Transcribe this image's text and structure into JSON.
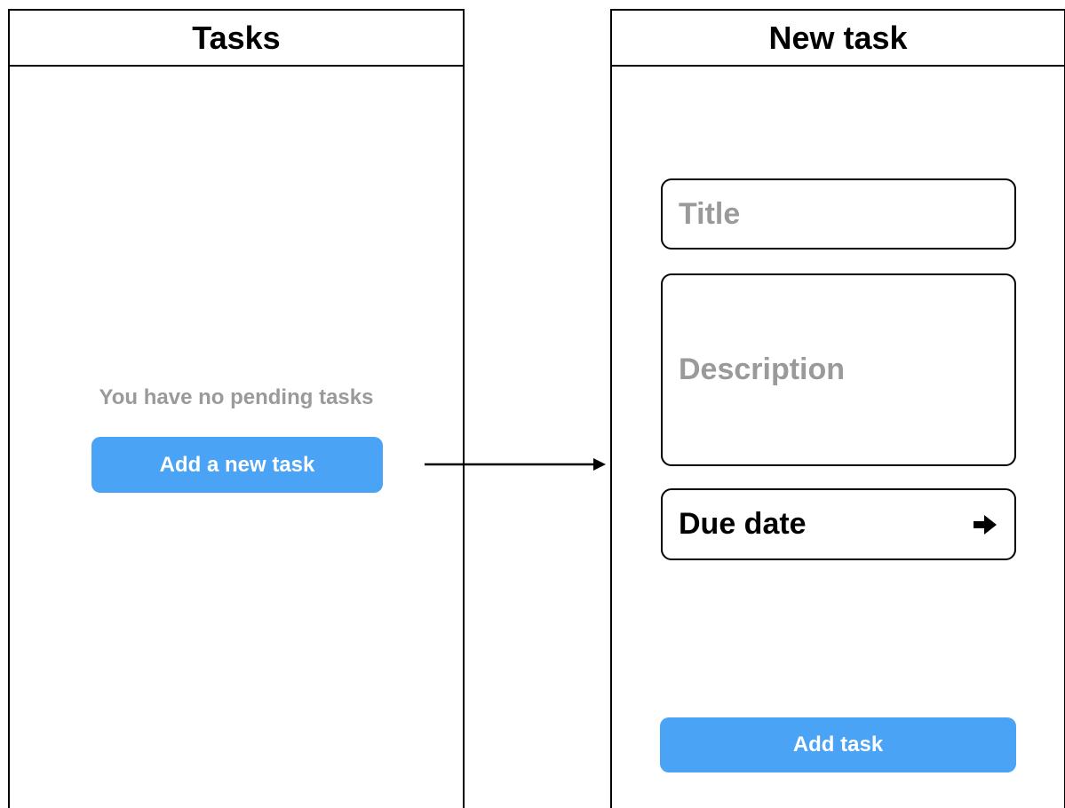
{
  "screens": {
    "tasks": {
      "title": "Tasks",
      "empty_message": "You have no pending tasks",
      "add_button_label": "Add a new task"
    },
    "new_task": {
      "title": "New task",
      "title_placeholder": "Title",
      "description_placeholder": "Description",
      "due_date_label": "Due date",
      "due_date_icon": "right-arrow-icon",
      "submit_label": "Add task"
    }
  },
  "flow": {
    "from": "Add a new task",
    "to": "New task"
  },
  "colors": {
    "accent": "#4aa3f5",
    "muted_text": "#9a9a9a",
    "border": "#000000"
  }
}
